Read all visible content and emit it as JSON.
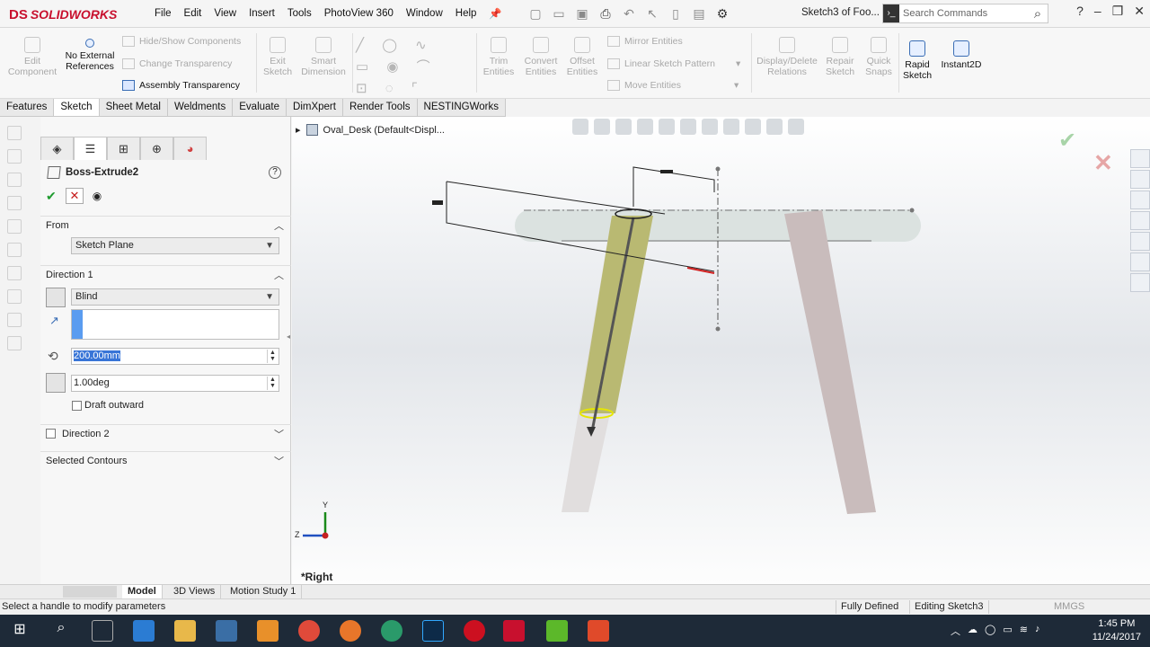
{
  "app": {
    "brand": "SOLIDWORKS",
    "brand_prefix": "DS",
    "doc_title": "Sketch3 of Foo..."
  },
  "menu": [
    "File",
    "Edit",
    "View",
    "Insert",
    "Tools",
    "PhotoView 360",
    "Window",
    "Help"
  ],
  "search": {
    "placeholder": "Search Commands"
  },
  "commands": {
    "edit_component": "Edit Component",
    "no_external_references": "No External References",
    "hide_show_components": "Hide/Show Components",
    "change_transparency": "Change Transparency",
    "assembly_transparency": "Assembly Transparency",
    "exit_sketch": "Exit Sketch",
    "smart_dimension": "Smart Dimension",
    "trim_entities": "Trim Entities",
    "convert_entities": "Convert Entities",
    "offset_entities": "Offset Entities",
    "mirror_entities": "Mirror Entities",
    "linear_sketch_pattern": "Linear Sketch Pattern",
    "move_entities": "Move Entities",
    "display_delete_relations": "Display/Delete Relations",
    "repair_sketch": "Repair Sketch",
    "quick_snaps": "Quick Snaps",
    "rapid_sketch": "Rapid Sketch",
    "instant2d": "Instant2D"
  },
  "tabs": [
    "Features",
    "Sketch",
    "Sheet Metal",
    "Weldments",
    "Evaluate",
    "DimXpert",
    "Render Tools",
    "NESTINGWorks"
  ],
  "active_tab": "Sketch",
  "property_manager": {
    "title": "Boss-Extrude2",
    "help": "?",
    "from_label": "From",
    "from_value": "Sketch Plane",
    "direction1_label": "Direction 1",
    "end_condition": "Blind",
    "depth": "200.00mm",
    "draft_angle": "1.00deg",
    "draft_outward": "Draft outward",
    "direction2_label": "Direction 2",
    "selected_contours": "Selected Contours"
  },
  "viewport": {
    "tree_item": "Oval_Desk  (Default<Displ...",
    "view_name": "*Right",
    "axis_y": "Y",
    "axis_z": "Z"
  },
  "bottom_tabs": [
    "Model",
    "3D Views",
    "Motion Study 1"
  ],
  "status": {
    "message": "Select a handle to modify parameters",
    "defined": "Fully Defined",
    "editing": "Editing Sketch3",
    "units": "MMGS"
  },
  "clock": {
    "time": "1:45 PM",
    "date": "11/24/2017"
  },
  "colors": {
    "brand_red": "#c8102e",
    "ok_green": "#1e9b2e",
    "selection_blue": "#3875d7",
    "leg_highlight": "#b8b86a"
  }
}
